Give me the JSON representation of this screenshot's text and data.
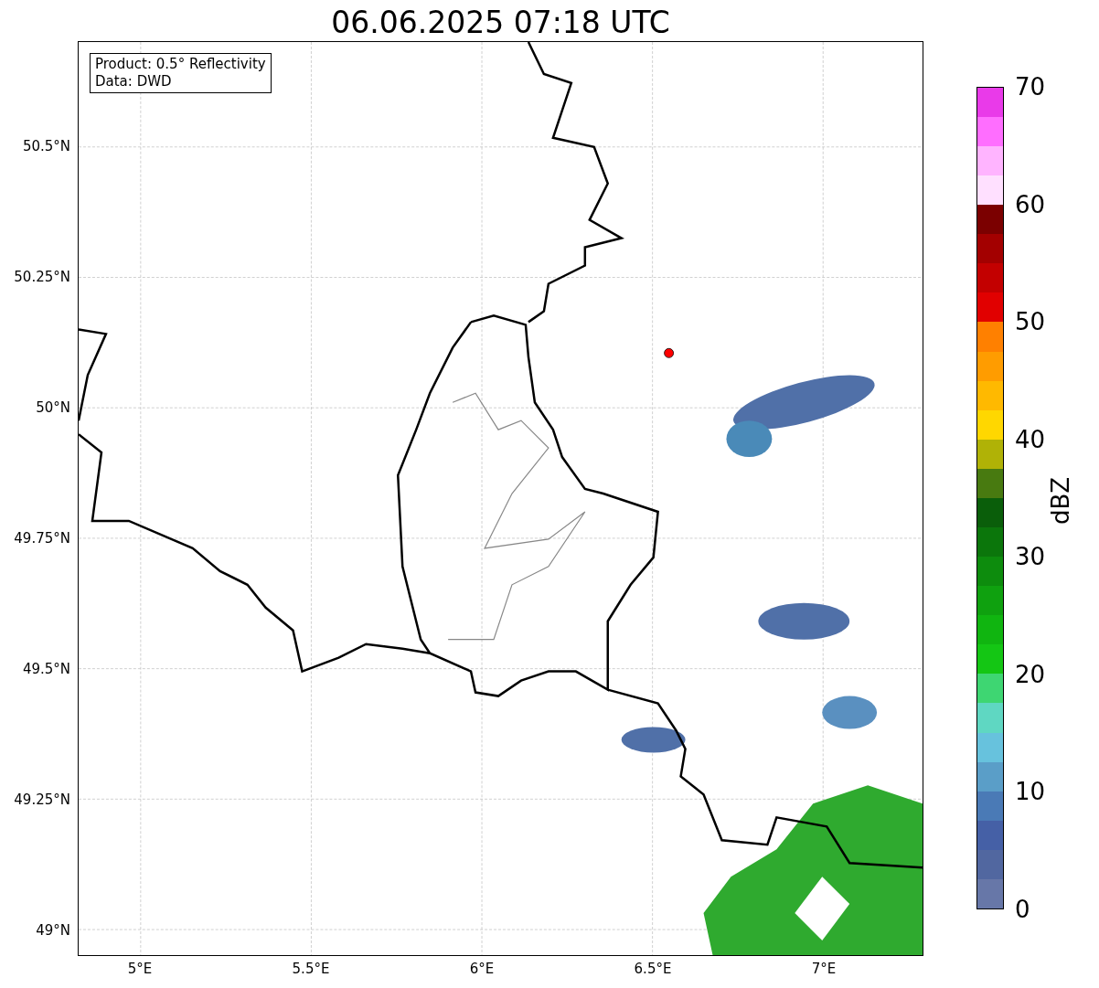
{
  "title": "06.06.2025 07:18 UTC",
  "legend": [
    "Product: 0.5° Reflectivity",
    "Data: DWD"
  ],
  "map": {
    "lat_ticks": [
      "50.5°N",
      "50.25°N",
      "50°N",
      "49.75°N",
      "49.5°N",
      "49.25°N",
      "49°N"
    ],
    "lon_ticks": [
      "5°E",
      "5.5°E",
      "6°E",
      "6.5°E",
      "7°E"
    ]
  },
  "colorbar": {
    "label": "dBZ",
    "ticks": [
      "70",
      "60",
      "50",
      "40",
      "30",
      "20",
      "10",
      "0"
    ],
    "bands": [
      {
        "color": "#6777a8"
      },
      {
        "color": "#5167a0"
      },
      {
        "color": "#4560a6"
      },
      {
        "color": "#4a7ab6"
      },
      {
        "color": "#5a9ec8"
      },
      {
        "color": "#67c2dd"
      },
      {
        "color": "#5fd7c2"
      },
      {
        "color": "#3ed672"
      },
      {
        "color": "#14c614"
      },
      {
        "color": "#10b510"
      },
      {
        "color": "#0fa10f"
      },
      {
        "color": "#0d8c0d"
      },
      {
        "color": "#0b760b"
      },
      {
        "color": "#0a5e0a"
      },
      {
        "color": "#487a10"
      },
      {
        "color": "#b0b206"
      },
      {
        "color": "#ffd700"
      },
      {
        "color": "#ffb900"
      },
      {
        "color": "#ff9c00"
      },
      {
        "color": "#ff8000"
      },
      {
        "color": "#e10000"
      },
      {
        "color": "#c30000"
      },
      {
        "color": "#a30000"
      },
      {
        "color": "#7b0000"
      },
      {
        "color": "#ffe0ff"
      },
      {
        "color": "#ffb4ff"
      },
      {
        "color": "#ff6eff"
      },
      {
        "color": "#e93ae9"
      }
    ]
  }
}
